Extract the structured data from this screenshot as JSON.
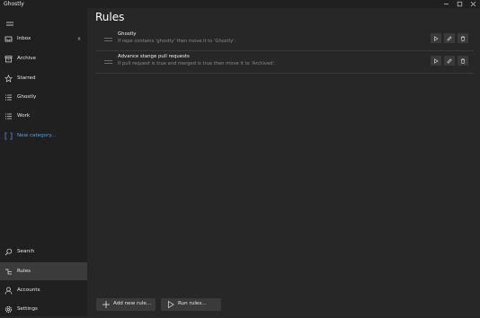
{
  "app": {
    "title": "Ghostly"
  },
  "sidebar": {
    "items": [
      {
        "label": "Inbox"
      },
      {
        "label": "Archive"
      },
      {
        "label": "Starred"
      },
      {
        "label": "Ghostly"
      },
      {
        "label": "Work"
      },
      {
        "label": "New category..."
      }
    ],
    "bottom_items": [
      {
        "label": "Search"
      },
      {
        "label": "Rules"
      },
      {
        "label": "Accounts"
      },
      {
        "label": "Settings"
      }
    ]
  },
  "main": {
    "title": "Rules",
    "rules": [
      {
        "name": "Ghostly",
        "description": "If repo contains 'ghostly' then move it to 'Ghostly'."
      },
      {
        "name": "Advance stange pull requests",
        "description": "If pull request is true and merged is true then move it to 'Archived'."
      }
    ],
    "footer": {
      "add_label": "Add new rule...",
      "run_label": "Run rules..."
    }
  },
  "colors": {
    "background": "#272727",
    "sidebar": "#202020",
    "accent": "#4ea3e6",
    "selected": "#3b3b3b"
  }
}
